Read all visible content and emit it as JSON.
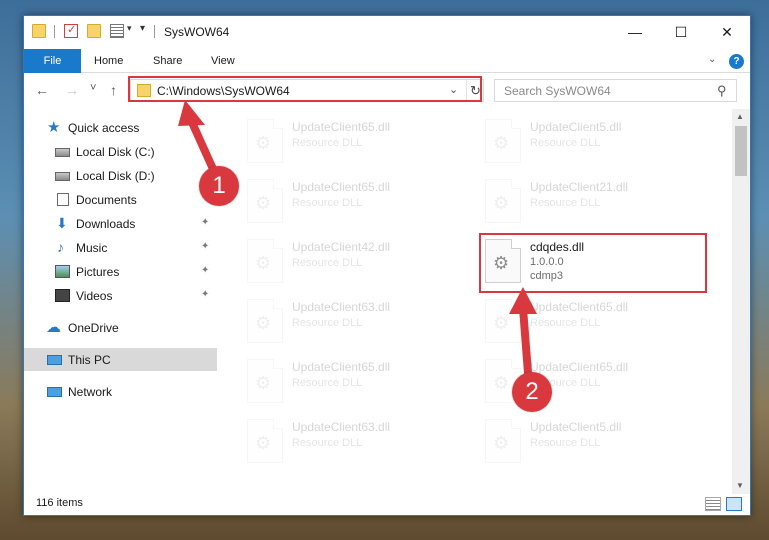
{
  "window": {
    "title": "SysWOW64",
    "controls": {
      "minimize": "—",
      "maximize": "☐",
      "close": "✕"
    }
  },
  "quick_access_toolbar": {
    "items": [
      "folder-icon",
      "properties-icon",
      "new-folder-icon",
      "view-options-icon"
    ],
    "dropdown_arrow": "▾",
    "customize_arrow": "▾"
  },
  "ribbon": {
    "tabs": [
      {
        "label": "File",
        "active": true
      },
      {
        "label": "Home"
      },
      {
        "label": "Share"
      },
      {
        "label": "View"
      }
    ],
    "help": "?"
  },
  "nav": {
    "back": "←",
    "forward": "→",
    "recent": "˅",
    "up": "↑",
    "address": "C:\\Windows\\SysWOW64",
    "address_chevron": "⌄",
    "refresh": "↻",
    "search_placeholder": "Search SysWOW64",
    "search_icon": "⚲"
  },
  "sidebar": {
    "items": [
      {
        "label": "Quick access",
        "icon": "star-icon",
        "glyph": "★"
      },
      {
        "label": "Local Disk (C:)",
        "icon": "disk-icon"
      },
      {
        "label": "Local Disk (D:)",
        "icon": "disk-icon"
      },
      {
        "label": "Documents",
        "icon": "documents-icon",
        "pin": "✦"
      },
      {
        "label": "Downloads",
        "icon": "downloads-icon",
        "glyph": "⬇",
        "pin": "✦"
      },
      {
        "label": "Music",
        "icon": "music-icon",
        "glyph": "♪",
        "pin": "✦"
      },
      {
        "label": "Pictures",
        "icon": "pictures-icon",
        "pin": "✦"
      },
      {
        "label": "Videos",
        "icon": "videos-icon",
        "pin": "✦"
      },
      {
        "label": "OneDrive",
        "icon": "cloud-icon",
        "glyph": "☁"
      },
      {
        "label": "This PC",
        "icon": "pc-icon",
        "selected": true
      },
      {
        "label": "Network",
        "icon": "network-icon"
      }
    ]
  },
  "files": {
    "gear_glyph": "⚙",
    "left_column": [
      {
        "name": "UpdateClient65.dll",
        "type": "Resource DLL"
      },
      {
        "name": "UpdateClient65.dll",
        "type": "Resource DLL"
      },
      {
        "name": "UpdateClient42.dll",
        "type": "Resource DLL"
      },
      {
        "name": "UpdateClient63.dll",
        "type": "Resource DLL"
      },
      {
        "name": "UpdateClient65.dll",
        "type": "Resource DLL"
      },
      {
        "name": "UpdateClient63.dll",
        "type": "Resource DLL"
      }
    ],
    "right_column": [
      {
        "name": "UpdateClient5.dll",
        "type": "Resource DLL"
      },
      {
        "name": "UpdateClient21.dll",
        "type": "Resource DLL"
      },
      {
        "name": "cdqdes.dll",
        "version": "1.0.0.0",
        "description": "cdmp3",
        "highlighted": true
      },
      {
        "name": "UpdateClient65.dll",
        "type": "Resource DLL"
      },
      {
        "name": "UpdateClient65.dll",
        "type": "Resource DLL"
      },
      {
        "name": "UpdateClient5.dll",
        "type": "Resource DLL"
      }
    ]
  },
  "status": {
    "item_count": "116 items"
  },
  "annotations": {
    "markers": [
      {
        "label": "1",
        "color": "#d9393e"
      },
      {
        "label": "2",
        "color": "#d9393e"
      }
    ]
  },
  "colors": {
    "accent": "#1979ca",
    "annotation_red": "#d9393e",
    "selection": "#d9d9d9"
  }
}
